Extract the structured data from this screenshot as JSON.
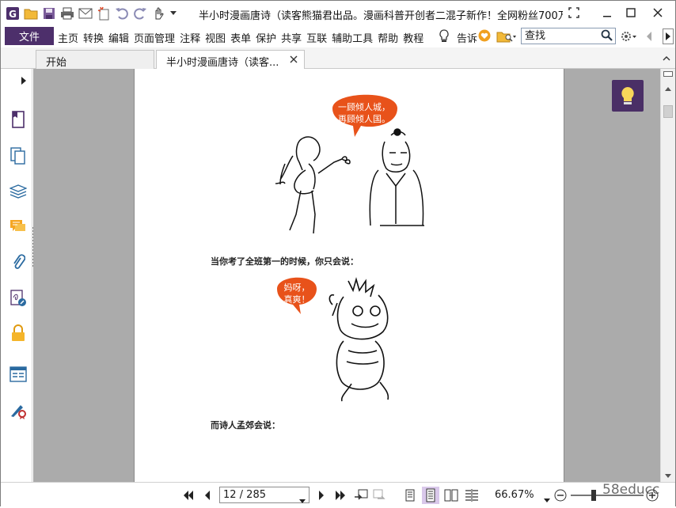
{
  "app": {
    "window_title": "半小时漫画唐诗（读客熊猫君出品。漫画科普开创者二混子新作！全网粉丝700万！"
  },
  "menu": {
    "file": "文件",
    "items": [
      "主页",
      "转换",
      "编辑",
      "页面管理",
      "注释",
      "视图",
      "表单",
      "保护",
      "共享",
      "互联",
      "辅助工具",
      "帮助",
      "教程"
    ],
    "tell_me": "告诉",
    "search_placeholder": "查找"
  },
  "tabs": [
    {
      "label": "开始",
      "active": false
    },
    {
      "label": "半小时漫画唐诗（读客...",
      "active": true
    }
  ],
  "document": {
    "bubble1_lines": [
      "一顾倾人城，",
      "再顾倾人国。"
    ],
    "caption1": "当你考了全班第一的时候，你只会说：",
    "bubble2_lines": [
      "妈呀，",
      "真爽！"
    ],
    "caption2": "而诗人孟郊会说："
  },
  "statusbar": {
    "page_indicator": "12 / 285",
    "zoom": "66.67%"
  },
  "watermark": "58educc",
  "colors": {
    "accent_purple": "#4d2f6b",
    "bubble_orange": "#e8521a",
    "doc_background": "#ababab"
  },
  "icons": {
    "sidebar": [
      "bookmark-icon",
      "pages-icon",
      "layers-icon",
      "comments-icon",
      "attachments-icon",
      "signature-icon",
      "security-icon",
      "form-fields-icon",
      "certify-icon"
    ]
  }
}
